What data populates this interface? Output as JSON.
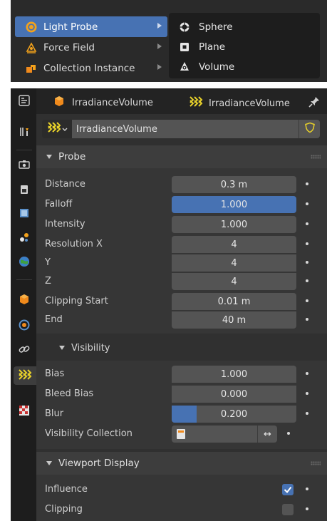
{
  "menu": {
    "items": [
      {
        "label": "Light Probe",
        "icon": "light-probe-icon",
        "active": true
      },
      {
        "label": "Force Field",
        "icon": "force-field-icon",
        "active": false
      },
      {
        "label": "Collection Instance",
        "icon": "collection-instance-icon",
        "active": false
      }
    ],
    "submenu": [
      {
        "label": "Sphere",
        "icon": "sphere-probe-icon"
      },
      {
        "label": "Plane",
        "icon": "plane-probe-icon"
      },
      {
        "label": "Volume",
        "icon": "volume-probe-icon"
      }
    ]
  },
  "header": {
    "object_name": "IrradianceVolume",
    "data_name": "IrradianceVolume"
  },
  "datablock": {
    "name": "IrradianceVolume"
  },
  "probe": {
    "title": "Probe",
    "distance_label": "Distance",
    "distance": "0.3 m",
    "falloff_label": "Falloff",
    "falloff": "1.000",
    "intensity_label": "Intensity",
    "intensity": "1.000",
    "resx_label": "Resolution X",
    "resx": "4",
    "y_label": "Y",
    "y": "4",
    "z_label": "Z",
    "z": "4",
    "clip_start_label": "Clipping Start",
    "clip_start": "0.01 m",
    "end_label": "End",
    "end": "40 m"
  },
  "visibility": {
    "title": "Visibility",
    "bias_label": "Bias",
    "bias": "1.000",
    "bleed_label": "Bleed Bias",
    "bleed": "0.000",
    "blur_label": "Blur",
    "blur": "0.200",
    "blur_fraction": 0.2,
    "collection_label": "Visibility Collection",
    "swap_symbol": "↔"
  },
  "viewport": {
    "title": "Viewport Display",
    "influence_label": "Influence",
    "influence": true,
    "clipping_label": "Clipping",
    "clipping": false
  },
  "colors": {
    "accent": "#4772b3",
    "field": "#545454",
    "panel": "#303030",
    "probe_yellow": "#e8d12a"
  }
}
